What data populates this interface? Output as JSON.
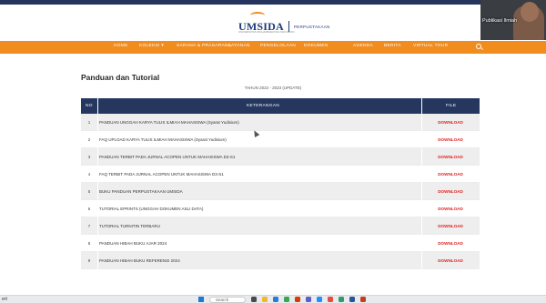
{
  "header": {
    "logo_text": "UMSIDA",
    "logo_sub": "PERPUSTAKAAN",
    "logo_tag": "UNIVERSITAS MUHAMMADIYAH SIDOARJO"
  },
  "webcam": {
    "name": "Publikasi Ilmiah"
  },
  "nav": {
    "items": [
      "HOME",
      "KOLEKSI",
      "SARANA & PRASARANA",
      "LAYANAN",
      "PENGELOLAAN",
      "DOKUMEN",
      "AGENDA",
      "BERITA",
      "VIRTUAL TOUR"
    ],
    "koleksi_caret": "▾"
  },
  "page": {
    "title": "Panduan dan Tutorial",
    "period": "TAHUN 2022 - 2023 (UPDATE)"
  },
  "table": {
    "headers": {
      "no": "NO",
      "desc": "KETERANGAN",
      "file": "FILE"
    },
    "rows": [
      {
        "no": "1",
        "desc": "PANDUAN UNGGAH KARYA TULIS ILMIAH MAHASISWA (Syarat Yudisium)",
        "file": "DOWNLOAD"
      },
      {
        "no": "2",
        "desc": "FAQ UPLOAD KARYA TULIS ILMIAH MAHASISWA (Syarat Yudisium)",
        "file": "DOWNLOAD"
      },
      {
        "no": "3",
        "desc": "PANDUAN TERBIT PADA JURNAL ACOPEN UNTUK MAHASISWA D3-S1",
        "file": "DOWNLOAD"
      },
      {
        "no": "4",
        "desc": "FAQ TERBIT PADA JURNAL ACOPEN UNTUK MAHASISWA D3-S1",
        "file": "DOWNLOAD"
      },
      {
        "no": "5",
        "desc": "BUKU PANDUAN PERPUSTAKAAN UMSIDA",
        "file": "DOWNLOAD"
      },
      {
        "no": "6",
        "desc": "TUTORIAL EPRINTS (UNGGAH DOKUMEN ASLI DATA)",
        "file": "DOWNLOAD"
      },
      {
        "no": "7",
        "desc": "TUTORIAL TURNITIN TERBARU",
        "file": "DOWNLOAD"
      },
      {
        "no": "8",
        "desc": "PANDUAN HIBAH BUKU AJAR 2024",
        "file": "DOWNLOAD"
      },
      {
        "no": "9",
        "desc": "PANDUAN HIBAH BUKU REFERENSI 2024",
        "file": "DOWNLOAD"
      }
    ]
  },
  "taskbar": {
    "left_text": "ert",
    "search_text": "Search"
  },
  "colors": {
    "nav_orange": "#f18c1e",
    "table_header_navy": "#25365f",
    "download_red": "#e02020"
  }
}
